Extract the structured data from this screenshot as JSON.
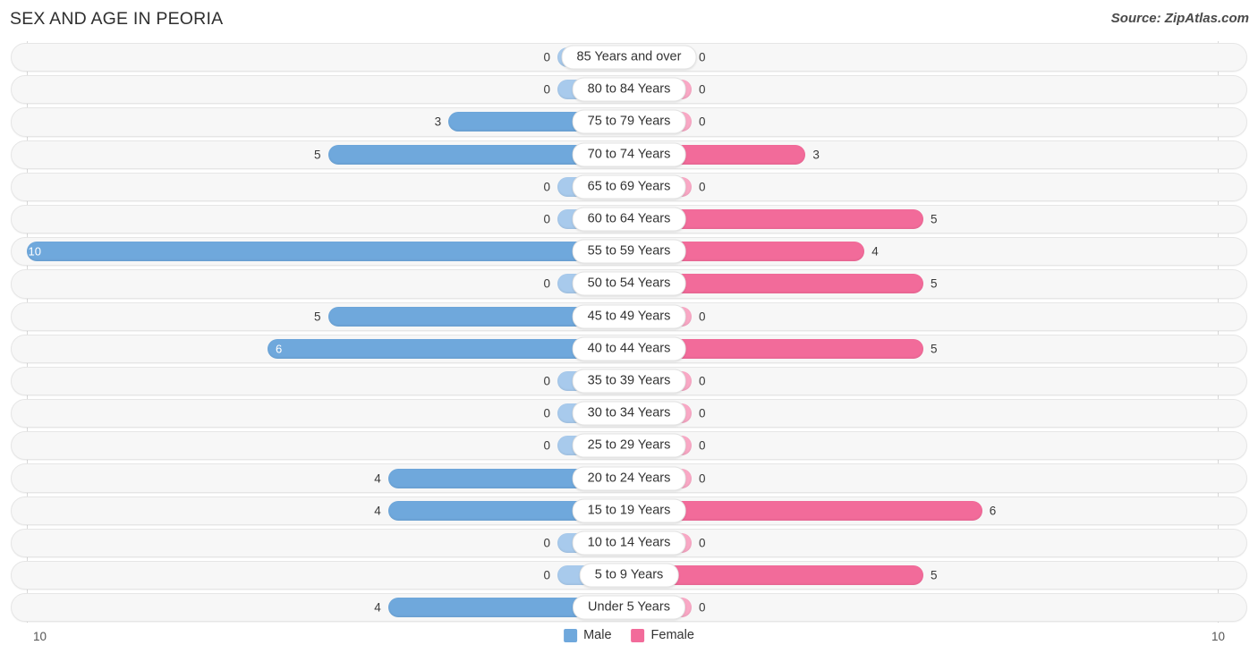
{
  "header": {
    "title": "SEX AND AGE IN PEORIA",
    "source": "Source: ZipAtlas.com"
  },
  "legend": {
    "male_label": "Male",
    "female_label": "Female",
    "male_color": "#6fa8dc",
    "female_color": "#f26b9a"
  },
  "axis": {
    "left_label": "10",
    "right_label": "10"
  },
  "colors": {
    "male_solid": "#6fa8dc",
    "male_light": "#a8caec",
    "female_solid": "#f26b9a",
    "female_light": "#f9a8c5",
    "track": "#f7f7f7",
    "gridline": "#d8d8d8"
  },
  "chart_data": {
    "type": "bar",
    "subtype": "population-pyramid",
    "title": "SEX AND AGE IN PEORIA",
    "xlabel": "",
    "ylabel": "",
    "xlim": [
      10,
      10
    ],
    "grid": true,
    "legend_position": "bottom-center",
    "categories": [
      "85 Years and over",
      "80 to 84 Years",
      "75 to 79 Years",
      "70 to 74 Years",
      "65 to 69 Years",
      "60 to 64 Years",
      "55 to 59 Years",
      "50 to 54 Years",
      "45 to 49 Years",
      "40 to 44 Years",
      "35 to 39 Years",
      "30 to 34 Years",
      "25 to 29 Years",
      "20 to 24 Years",
      "15 to 19 Years",
      "10 to 14 Years",
      "5 to 9 Years",
      "Under 5 Years"
    ],
    "series": [
      {
        "name": "Male",
        "values": [
          0,
          0,
          3,
          5,
          0,
          0,
          10,
          0,
          5,
          6,
          0,
          0,
          0,
          4,
          4,
          0,
          0,
          4
        ]
      },
      {
        "name": "Female",
        "values": [
          0,
          0,
          0,
          3,
          0,
          5,
          4,
          5,
          0,
          5,
          0,
          0,
          0,
          0,
          6,
          0,
          5,
          0
        ]
      }
    ]
  },
  "rows": [
    {
      "label": "85 Years and over",
      "male": "0",
      "female": "0"
    },
    {
      "label": "80 to 84 Years",
      "male": "0",
      "female": "0"
    },
    {
      "label": "75 to 79 Years",
      "male": "3",
      "female": "0"
    },
    {
      "label": "70 to 74 Years",
      "male": "5",
      "female": "3"
    },
    {
      "label": "65 to 69 Years",
      "male": "0",
      "female": "0"
    },
    {
      "label": "60 to 64 Years",
      "male": "0",
      "female": "5"
    },
    {
      "label": "55 to 59 Years",
      "male": "10",
      "female": "4"
    },
    {
      "label": "50 to 54 Years",
      "male": "0",
      "female": "5"
    },
    {
      "label": "45 to 49 Years",
      "male": "5",
      "female": "0"
    },
    {
      "label": "40 to 44 Years",
      "male": "6",
      "female": "5"
    },
    {
      "label": "35 to 39 Years",
      "male": "0",
      "female": "0"
    },
    {
      "label": "30 to 34 Years",
      "male": "0",
      "female": "0"
    },
    {
      "label": "25 to 29 Years",
      "male": "0",
      "female": "0"
    },
    {
      "label": "20 to 24 Years",
      "male": "4",
      "female": "0"
    },
    {
      "label": "15 to 19 Years",
      "male": "4",
      "female": "6"
    },
    {
      "label": "10 to 14 Years",
      "male": "0",
      "female": "0"
    },
    {
      "label": "5 to 9 Years",
      "male": "0",
      "female": "5"
    },
    {
      "label": "Under 5 Years",
      "male": "4",
      "female": "0"
    }
  ]
}
